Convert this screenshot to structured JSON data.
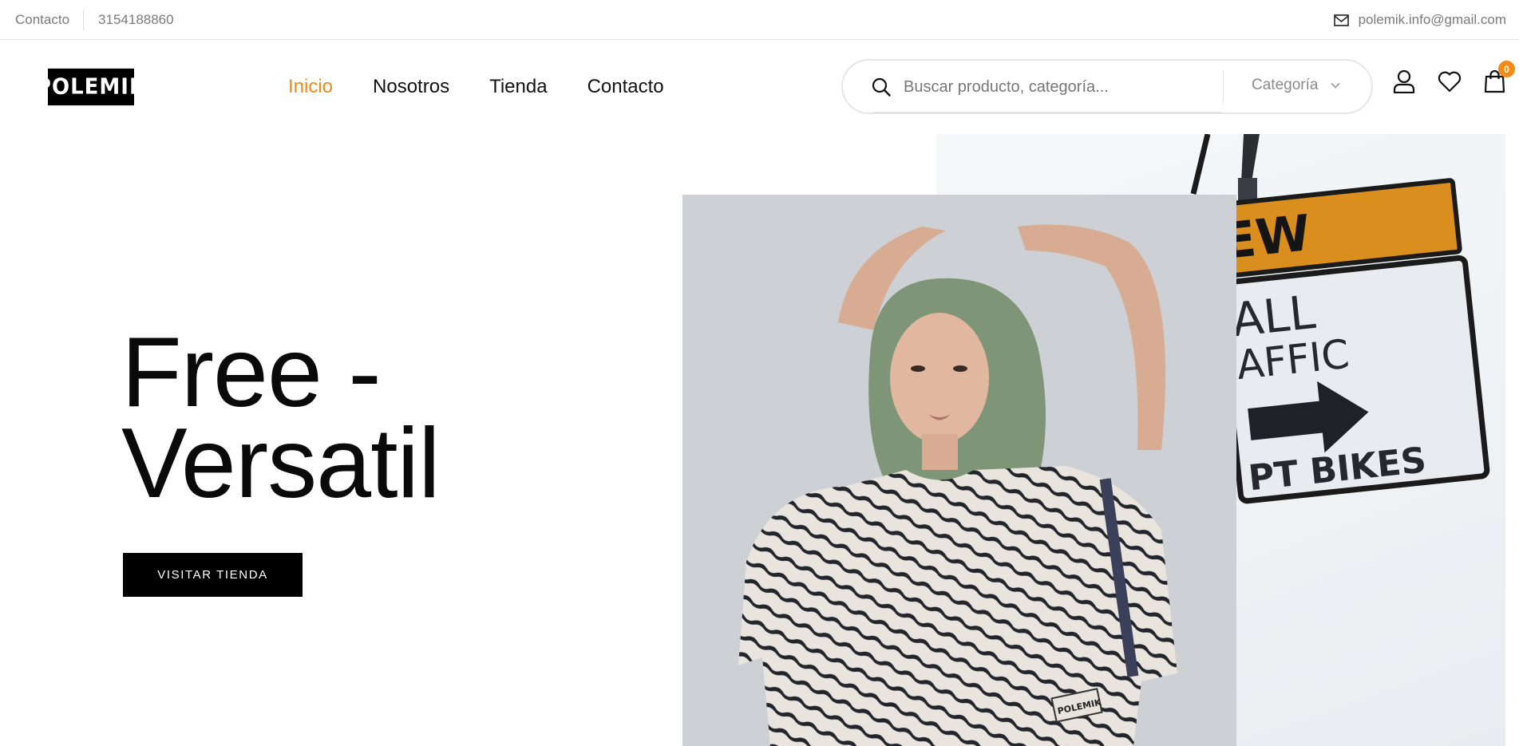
{
  "topbar": {
    "contact_label": "Contacto",
    "phone": "3154188860",
    "email": "polemik.info@gmail.com"
  },
  "header": {
    "logo_text": "POLEMIK",
    "nav": [
      {
        "label": "Inicio",
        "active": true
      },
      {
        "label": "Nosotros",
        "active": false
      },
      {
        "label": "Tienda",
        "active": false
      },
      {
        "label": "Contacto",
        "active": false
      }
    ],
    "search": {
      "placeholder": "Buscar producto, categoría...",
      "value": "",
      "category_label": "Categoría"
    },
    "icons": [
      "user-icon",
      "heart-icon",
      "shopping-bag-icon",
      "search-icon",
      "chevron-down-icon",
      "mail-icon"
    ],
    "cart_count": "0"
  },
  "hero": {
    "title_line1": "Free -",
    "title_line2": "Versatil",
    "cta_label": "VISITAR TIENDA",
    "sign_text": [
      "EW",
      "ALL",
      "AFFIC",
      "PT BIKES"
    ],
    "shirt_tag": "POLEMIK"
  },
  "colors": {
    "accent": "#f28a14",
    "text": "#111111",
    "muted": "#7a7a7a",
    "button_bg": "#000000"
  }
}
